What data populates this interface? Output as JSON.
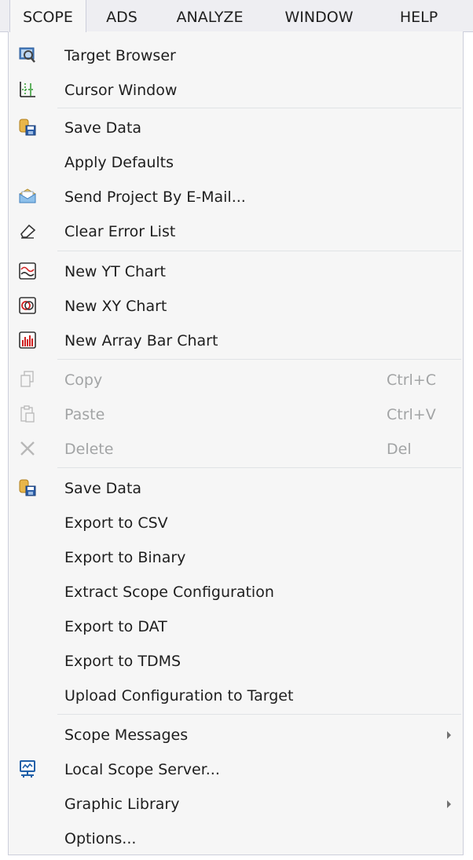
{
  "menubar": {
    "items": [
      {
        "label": "SCOPE",
        "active": true
      },
      {
        "label": "ADS"
      },
      {
        "label": "ANALYZE"
      },
      {
        "label": "WINDOW"
      },
      {
        "label": "HELP"
      }
    ]
  },
  "menu": {
    "target_browser": {
      "label": "Target Browser",
      "icon": "target-browser-icon"
    },
    "cursor_window": {
      "label": "Cursor Window",
      "icon": "cursor-window-icon"
    },
    "save_data_1": {
      "label": "Save Data",
      "icon": "save-data-icon"
    },
    "apply_defaults": {
      "label": "Apply Defaults"
    },
    "send_email": {
      "label": "Send Project By E-Mail...",
      "icon": "email-envelope-icon"
    },
    "clear_errors": {
      "label": "Clear Error List",
      "icon": "eraser-icon"
    },
    "new_yt": {
      "label": "New YT Chart",
      "icon": "yt-chart-icon"
    },
    "new_xy": {
      "label": "New XY Chart",
      "icon": "xy-chart-icon"
    },
    "new_bar": {
      "label": "New Array Bar Chart",
      "icon": "array-bar-chart-icon"
    },
    "copy": {
      "label": "Copy",
      "shortcut": "Ctrl+C",
      "icon": "copy-icon",
      "disabled": true
    },
    "paste": {
      "label": "Paste",
      "shortcut": "Ctrl+V",
      "icon": "paste-icon",
      "disabled": true
    },
    "delete": {
      "label": "Delete",
      "shortcut": "Del",
      "icon": "delete-x-icon",
      "disabled": true
    },
    "save_data_2": {
      "label": "Save Data",
      "icon": "save-data-icon"
    },
    "export_csv": {
      "label": "Export to CSV"
    },
    "export_binary": {
      "label": "Export to Binary"
    },
    "extract_config": {
      "label": "Extract Scope Configuration"
    },
    "export_dat": {
      "label": "Export to DAT"
    },
    "export_tdms": {
      "label": "Export to TDMS"
    },
    "upload_config": {
      "label": "Upload Configuration to Target"
    },
    "scope_messages": {
      "label": "Scope Messages",
      "submenu": true
    },
    "local_server": {
      "label": "Local Scope Server...",
      "icon": "local-server-icon"
    },
    "graphic_library": {
      "label": "Graphic Library",
      "submenu": true
    },
    "options": {
      "label": "Options..."
    }
  },
  "colors": {
    "menubar_bg": "#eeeef2",
    "menu_bg": "#f6f6f6",
    "border": "#cccedb",
    "separator": "#e0e3e6",
    "text": "#1e1e1e",
    "disabled_text": "#a2a4a5",
    "accent_blue": "#1f5fa8"
  }
}
